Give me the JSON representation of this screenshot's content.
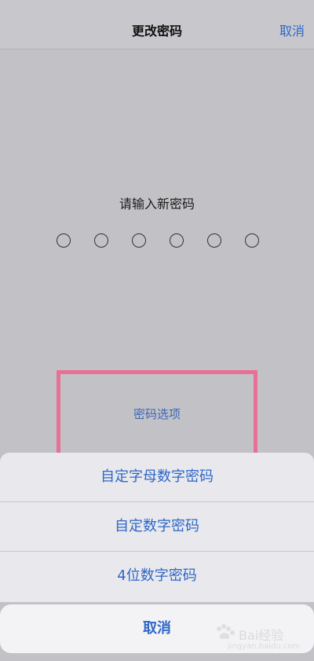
{
  "navbar": {
    "title": "更改密码",
    "cancel_label": "取消"
  },
  "passcode": {
    "prompt": "请输入新密码",
    "digit_count": 6
  },
  "passcode_options": {
    "label": "密码选项"
  },
  "action_sheet": {
    "items": [
      {
        "label": "自定字母数字密码"
      },
      {
        "label": "自定数字密码"
      },
      {
        "label": "4位数字密码"
      }
    ],
    "cancel_label": "取消"
  },
  "watermark": {
    "title": "Bai经验",
    "subtitle": "jingyan.baidu.com"
  },
  "colors": {
    "accent": "#2e66c7",
    "highlight_border": "#ea6f95",
    "background": "#c2c2c6"
  }
}
